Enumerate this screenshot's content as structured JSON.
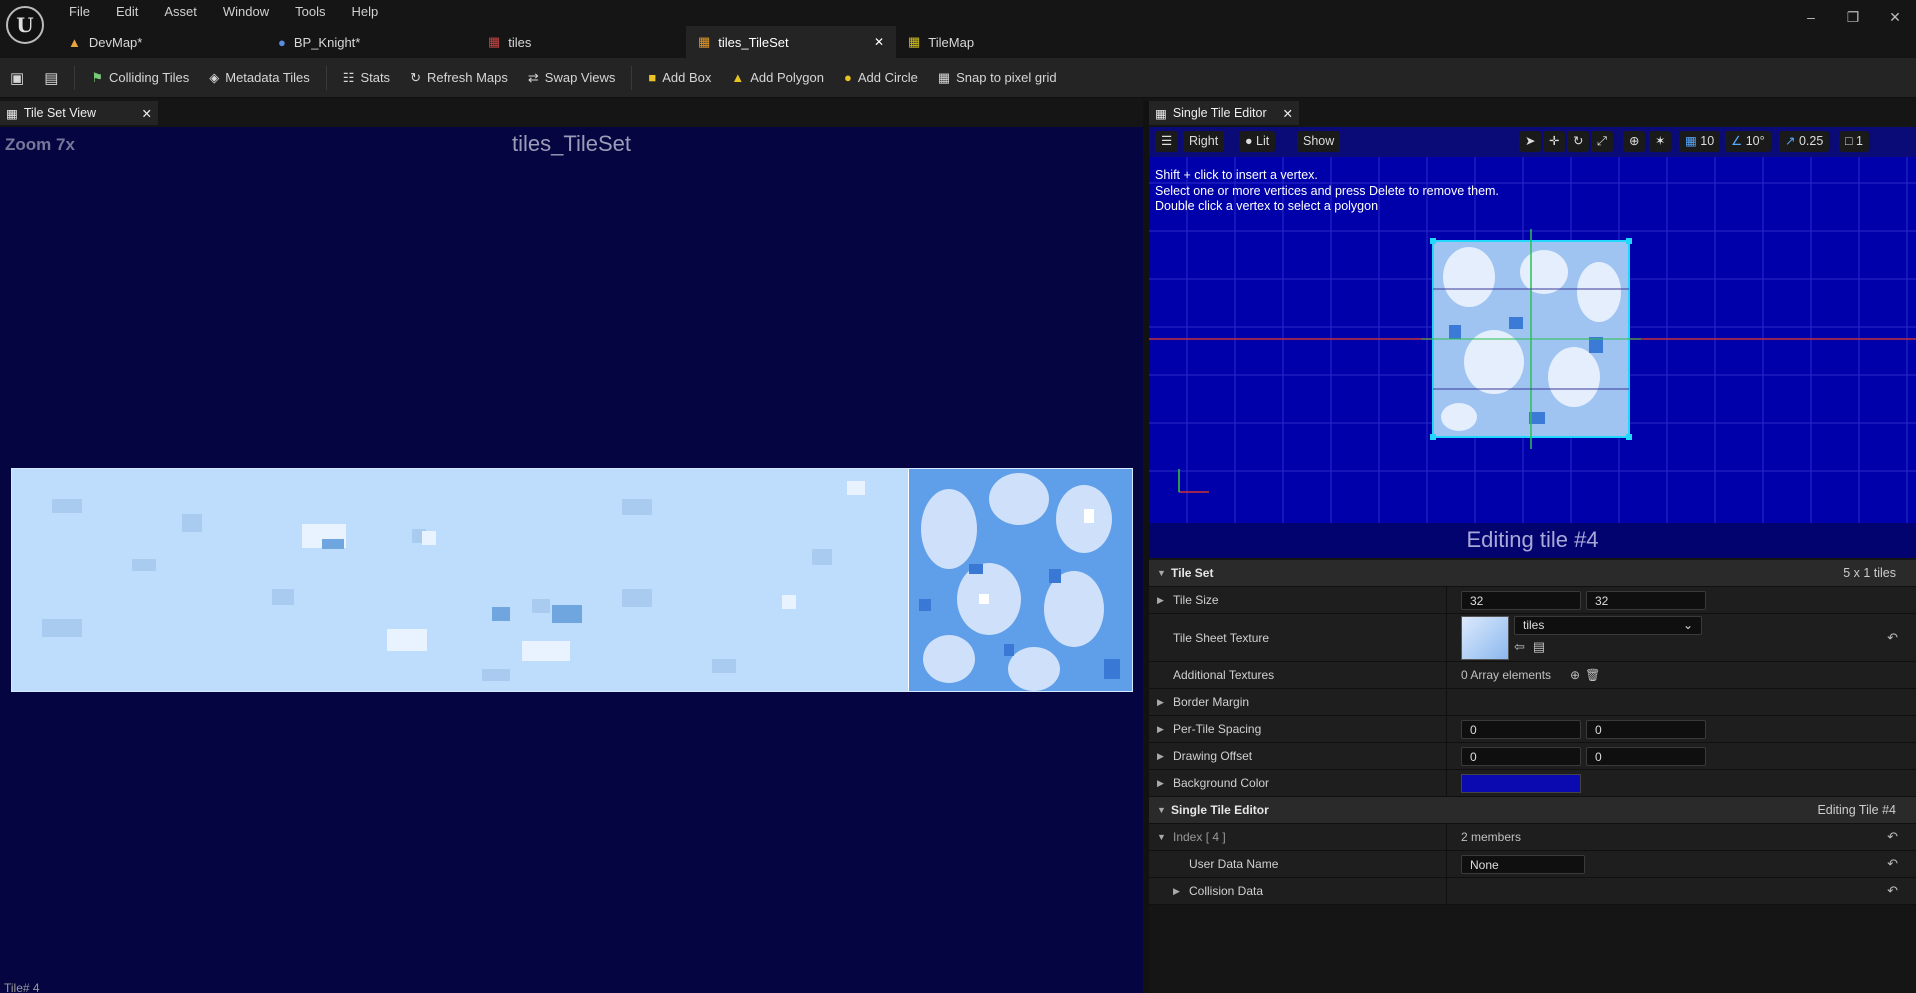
{
  "menu": [
    "File",
    "Edit",
    "Asset",
    "Window",
    "Tools",
    "Help"
  ],
  "tabs": [
    {
      "label": "DevMap*",
      "icon": "level-icon"
    },
    {
      "label": "BP_Knight*",
      "icon": "blueprint-icon"
    },
    {
      "label": "tiles",
      "icon": "texture-icon"
    },
    {
      "label": "tiles_TileSet",
      "icon": "tileset-icon"
    },
    {
      "label": "TileMap",
      "icon": "tilemap-icon"
    }
  ],
  "toolbar": {
    "colliding": "Colliding Tiles",
    "metadata": "Metadata Tiles",
    "stats": "Stats",
    "refresh": "Refresh Maps",
    "swap": "Swap Views",
    "addbox": "Add Box",
    "addpoly": "Add Polygon",
    "addcircle": "Add Circle",
    "snap": "Snap to pixel grid"
  },
  "left": {
    "tab": "Tile Set View",
    "zoom": "Zoom 7x",
    "name": "tiles_TileSet",
    "tile_label": "Tile# 4"
  },
  "right": {
    "tab": "Single Tile Editor",
    "view": "Right",
    "lit": "Lit",
    "show": "Show",
    "grid": "10",
    "angle": "10°",
    "scale": "0.25",
    "cam": "1",
    "instr1": "Shift + click to insert a vertex.",
    "instr2": "Select one or more vertices and press Delete to remove them.",
    "instr3": "Double click a vertex to select a polygon",
    "editing": "Editing tile #4"
  },
  "details": {
    "tileset_cat": "Tile Set",
    "tileset_count": "5 x 1 tiles",
    "tilesize_label": "Tile Size",
    "tilesize_x": "32",
    "tilesize_y": "32",
    "texture_label": "Tile Sheet Texture",
    "texture_value": "tiles",
    "addtex_label": "Additional Textures",
    "addtex_value": "0 Array elements",
    "border_label": "Border Margin",
    "spacing_label": "Per-Tile Spacing",
    "spacing_x": "0",
    "spacing_y": "0",
    "offset_label": "Drawing Offset",
    "offset_x": "0",
    "offset_y": "0",
    "bg_label": "Background Color",
    "bg_color": "#0a0ab0",
    "ste_cat": "Single Tile Editor",
    "ste_right": "Editing Tile #4",
    "index_label": "Index [ 4 ]",
    "index_value": "2 members",
    "udn_label": "User Data Name",
    "udn_value": "None",
    "coll_label": "Collision Data"
  }
}
